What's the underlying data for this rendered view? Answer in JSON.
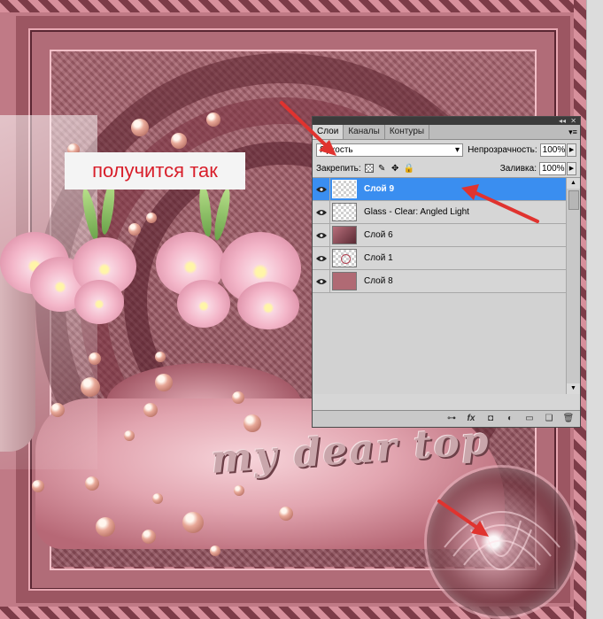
{
  "caption": "получится так",
  "watermark": "my dear top",
  "panel": {
    "tabs": [
      {
        "label": "Слои",
        "active": true
      },
      {
        "label": "Каналы",
        "active": false
      },
      {
        "label": "Контуры",
        "active": false
      }
    ],
    "collapse_glyph": "◂◂",
    "close_glyph": "✕",
    "menu_glyph": "▾≡",
    "blend_mode": "Яркость",
    "opacity_label": "Непрозрачность:",
    "opacity_value": "100%",
    "lock_label": "Закрепить:",
    "fill_label": "Заливка:",
    "fill_value": "100%",
    "layers": [
      {
        "name": "Слой 9",
        "selected": true,
        "thumb": "transparent"
      },
      {
        "name": "Glass - Clear: Angled Light",
        "selected": false,
        "thumb": "transparent"
      },
      {
        "name": "Слой 6",
        "selected": false,
        "thumb": "image"
      },
      {
        "name": "Слой 1",
        "selected": false,
        "thumb": "shape"
      },
      {
        "name": "Слой 8",
        "selected": false,
        "thumb": "solid"
      }
    ],
    "footer_icons": [
      "link-icon",
      "fx-icon",
      "mask-icon",
      "adjustment-icon",
      "group-folder-icon",
      "new-layer-icon",
      "trash-icon"
    ],
    "footer_glyphs": {
      "link": "⊶",
      "fx": "fx",
      "mask": "◘",
      "adjust": "◐",
      "folder": "▭",
      "new": "❏",
      "trash": "🗑"
    }
  },
  "colors": {
    "arrow": "#e0332f",
    "selection": "#3a8ef0",
    "caption_text": "#d81e2a"
  }
}
